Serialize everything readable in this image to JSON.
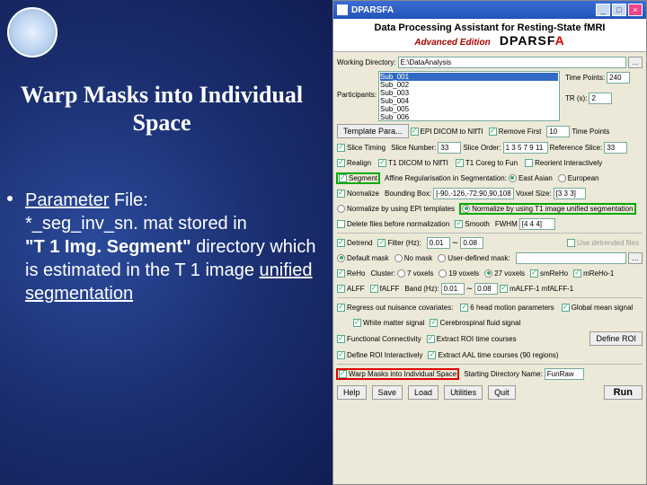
{
  "slide": {
    "title": "Warp Masks into Individual Space",
    "bullet": {
      "label_param": "Parameter",
      "label_file": " File:",
      "line2": "*_seg_inv_sn. mat stored in",
      "line3a": "\"T 1 Img. Segment\"",
      "line3b": " directory which is estimated in the T 1 image ",
      "line3c": "unified segmentation"
    }
  },
  "titlebar": {
    "title": "DPARSFA",
    "min": "_",
    "max": "□",
    "close": "×"
  },
  "header": {
    "l1": "Data Processing Assistant for Resting-State fMRI",
    "l2": "Advanced Edition",
    "l3a": "DPARSF",
    "l3b": "A"
  },
  "wd": {
    "label": "Working Directory:",
    "value": "E:\\DataAnalysis",
    "dots": "..."
  },
  "participants": {
    "label": "Participants:",
    "items": [
      "Sub_001",
      "Sub_002",
      "Sub_003",
      "Sub_004",
      "Sub_005",
      "Sub_006"
    ],
    "tp_label": "Time Points:",
    "tp": "240",
    "tr_label": "TR (s):",
    "tr": "2"
  },
  "template": {
    "label": "Template Para...",
    "ep": "EPI DICOM to NIfTI",
    "rm": "Remove First",
    "rm_val": "10",
    "rm_unit": "Time Points"
  },
  "slice": {
    "st": "Slice Timing",
    "sn": "Slice Number:",
    "sn_v": "33",
    "so": "Slice Order:",
    "so_v": "1 3 5 7 9 11",
    "rs": "Reference Slice:",
    "rs_v": "33"
  },
  "realign": {
    "re": "Realign",
    "t1d": "T1 DICOM to NIfTI",
    "t1c": "T1 Coreg to Fun",
    "ri": "Reorient Interactively"
  },
  "segment": {
    "seg": "Segment",
    "aff": "Affine Regularisation in Segmentation:",
    "ea": "East Asian",
    "eu": "European"
  },
  "normalize": {
    "nm": "Normalize",
    "bb": "Bounding Box:",
    "bb_v": "[-90,-126,-72;90,90,108]",
    "vs": "Voxel Size:",
    "vs_v": "[3 3 3]"
  },
  "normopt": {
    "epi": "Normalize by using EPI templates",
    "t1": "Normalize by using T1 image unified segmentation"
  },
  "del_smo": {
    "del": "Delete files before normalization",
    "sm": "Smooth",
    "fw": "FWHM",
    "fw_v": "[4 4 4]"
  },
  "detrend": {
    "dt": "Detrend",
    "fl": "Filter (Hz):",
    "lo": "0.01",
    "til": "∼",
    "hi": "0.08",
    "ud": "Use detrended files"
  },
  "mask": {
    "dm": "Default mask",
    "nm": "No mask",
    "um": "User-defined mask:",
    "dots": "..."
  },
  "reho": {
    "rh": "ReHo",
    "cl": "Cluster:",
    "v7": "7 voxels",
    "v19": "19 voxels",
    "v27": "27 voxels",
    "sr": "smReHo",
    "mr": "mReHo-1"
  },
  "alff": {
    "al": "ALFF",
    "fa": "fALFF",
    "bd": "Band (Hz):",
    "lo": "0.01",
    "til": "∼",
    "hi": "0.08",
    "ma": "mALFF-1 mfALFF-1"
  },
  "cov": {
    "rc": "Regress out nuisance covariates:",
    "hm": "6 head motion parameters",
    "gm": "Global mean signal"
  },
  "wmcsf": {
    "wm": "White matter signal",
    "csf": "Cerebrospinal fluid signal"
  },
  "fc": {
    "fc": "Functional Connectivity",
    "ex": "Extract ROI time courses",
    "dr": "Define ROI"
  },
  "roi": {
    "di": "Define ROI Interactively",
    "aal": "Extract AAL time courses (90 regions)"
  },
  "warp": {
    "wm": "Warp Masks into Individual Space",
    "sd": "Starting Directory Name:",
    "sd_v": "FunRaw"
  },
  "buttons": {
    "help": "Help",
    "save": "Save",
    "load": "Load",
    "util": "Utilities",
    "quit": "Quit",
    "run": "Run"
  }
}
